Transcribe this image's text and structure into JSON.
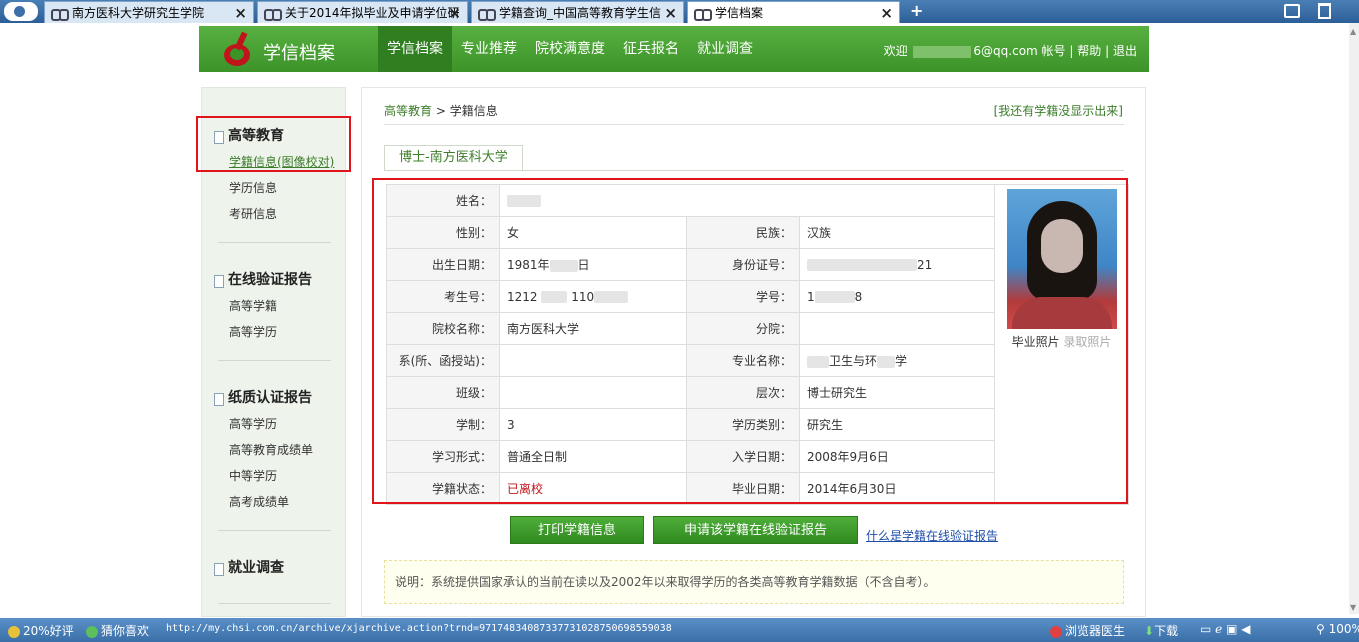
{
  "tabs": [
    {
      "title": "南方医科大学研究生学院"
    },
    {
      "title": "关于2014年拟毕业及申请学位研"
    },
    {
      "title": "学籍查询_中国高等教育学生信"
    },
    {
      "title": "学信档案"
    }
  ],
  "header": {
    "site_title": "学信档案",
    "nav": [
      "学信档案",
      "专业推荐",
      "院校满意度",
      "征兵报名",
      "就业调查"
    ],
    "welcome": "欢迎",
    "email_suffix": "6@qq.com",
    "account": "帐号",
    "sep": "|",
    "help": "帮助",
    "logout": "退出"
  },
  "sidebar": {
    "sections": [
      {
        "title": "高等教育",
        "items": [
          "学籍信息(图像校对)",
          "学历信息",
          "考研信息"
        ]
      },
      {
        "title": "在线验证报告",
        "items": [
          "高等学籍",
          "高等学历"
        ]
      },
      {
        "title": "纸质认证报告",
        "items": [
          "高等学历",
          "高等教育成绩单",
          "中等学历",
          "高考成绩单"
        ]
      },
      {
        "title": "就业调查",
        "items": []
      }
    ]
  },
  "main": {
    "breadcrumb_home": "高等教育",
    "breadcrumb_sep": " > ",
    "breadcrumb_current": "学籍信息",
    "not_shown_link": "[我还有学籍没显示出来]",
    "school_tab": "博士-南方医科大学",
    "rows": [
      {
        "l1": "姓名：",
        "v1": "",
        "l2": "",
        "v2": ""
      },
      {
        "l1": "性别：",
        "v1": "女",
        "l2": "民族：",
        "v2": "汉族"
      },
      {
        "l1": "出生日期：",
        "v1": "1981年",
        "v1b": "日",
        "l2": "身份证号：",
        "v2": "21"
      },
      {
        "l1": "考生号：",
        "v1": "1212",
        "v1b": "110",
        "l2": "学号：",
        "v2": "1",
        "v2b": "8"
      },
      {
        "l1": "院校名称：",
        "v1": "南方医科大学",
        "l2": "分院：",
        "v2": ""
      },
      {
        "l1": "系(所、函授站)：",
        "v1": "",
        "l2": "专业名称：",
        "v2": "卫生与环",
        "v2b": "学"
      },
      {
        "l1": "班级：",
        "v1": "",
        "l2": "层次：",
        "v2": "博士研究生"
      },
      {
        "l1": "学制：",
        "v1": "3",
        "l2": "学历类别：",
        "v2": "研究生"
      },
      {
        "l1": "学习形式：",
        "v1": "普通全日制",
        "l2": "入学日期：",
        "v2": "2008年9月6日"
      },
      {
        "l1": "学籍状态：",
        "v1": "已离校",
        "l2": "毕业日期：",
        "v2": "2014年6月30日"
      }
    ],
    "photo_caption": "毕业照片",
    "photo_caption2": "录取照片",
    "print_btn": "打印学籍信息",
    "apply_btn": "申请该学籍在线验证报告",
    "what_link": "什么是学籍在线验证报告",
    "note": "说明：系统提供国家承认的当前在读以及2002年以来取得学历的各类高等教育学籍数据（不含自考）。"
  },
  "statusbar": {
    "rating": "20%好评",
    "guess": "猜你喜欢",
    "url": "http://my.chsi.com.cn/archive/xjarchive.action?trnd=97174834087337731028750698559038",
    "doctor": "浏览器医生",
    "download": "下载",
    "zoom": "100%"
  }
}
